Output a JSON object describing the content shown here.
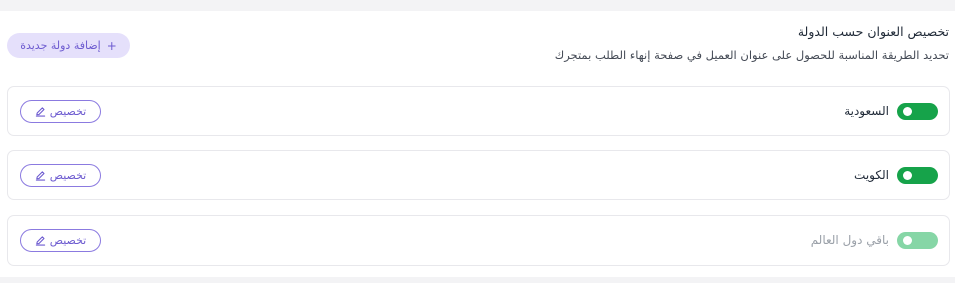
{
  "header": {
    "title": "تخصيص العنوان حسب الدولة",
    "description": "تحديد الطريقة المناسبة للحصول على عنوان العميل في صفحة إنهاء الطلب بمتجرك",
    "add_button_label": "إضافة دولة جديدة",
    "add_button_icon": "plus-icon"
  },
  "rows": [
    {
      "country": "السعودية",
      "enabled": true,
      "customize_label": "تخصيص",
      "customize_icon": "pencil-icon"
    },
    {
      "country": "الكويت",
      "enabled": true,
      "customize_label": "تخصيص",
      "customize_icon": "pencil-icon"
    },
    {
      "country": "باقي دول العالم",
      "enabled": true,
      "disabled_style": true,
      "customize_label": "تخصيص",
      "customize_icon": "pencil-icon"
    }
  ],
  "colors": {
    "accent": "#6d5bd0",
    "accent_bg": "#e5e0fb",
    "toggle_on": "#16a34a",
    "toggle_faded": "#86d6a6"
  }
}
